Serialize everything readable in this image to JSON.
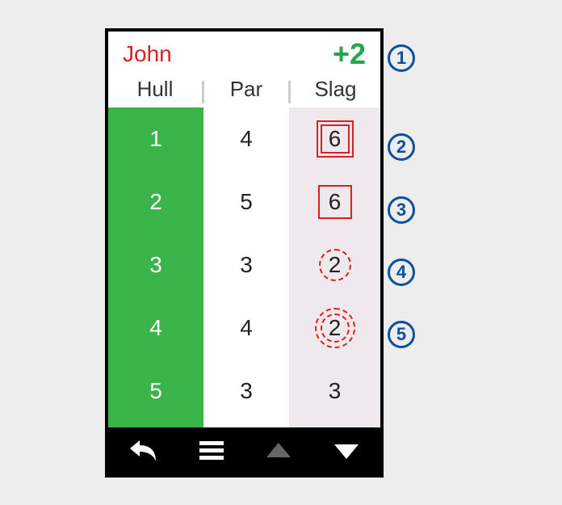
{
  "header": {
    "player_name": "John",
    "score_diff": "+2"
  },
  "columns": {
    "hull": "Hull",
    "par": "Par",
    "slag": "Slag"
  },
  "rows": [
    {
      "hull": "1",
      "par": "4",
      "slag": "6",
      "decoration": "double-square"
    },
    {
      "hull": "2",
      "par": "5",
      "slag": "6",
      "decoration": "single-square"
    },
    {
      "hull": "3",
      "par": "3",
      "slag": "2",
      "decoration": "dashed-circle"
    },
    {
      "hull": "4",
      "par": "4",
      "slag": "2",
      "decoration": "double-dashed-circle"
    },
    {
      "hull": "5",
      "par": "3",
      "slag": "3",
      "decoration": "none"
    }
  ],
  "callouts": [
    "1",
    "2",
    "3",
    "4",
    "5"
  ]
}
